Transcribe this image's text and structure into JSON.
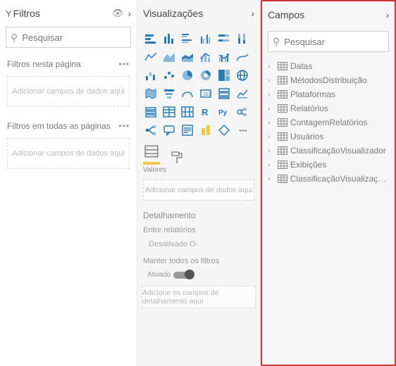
{
  "filters": {
    "title": "Filtros",
    "search_placeholder": "Pesquisar",
    "section_page": "Filtros nesta página",
    "section_all": "Filtros em todas as páginas",
    "dropzone_text": "Adicionar campos de dados aqui"
  },
  "viz": {
    "title": "Visualizações",
    "values_label": "Valores",
    "dropzone_text": "Adicionar campos de dados aqui",
    "drill_header": "Detalhamento",
    "cross_report_label": "Entre relatórios",
    "cross_report_state": "Desativado O-",
    "keep_filters_label": "Manter todos os filtros",
    "keep_filters_state": "Ativado",
    "drill_dropzone": "Adicione os campos de detalhamento aqui",
    "icons": [
      "stacked-bar",
      "stacked-column",
      "clustered-bar",
      "clustered-column",
      "hundred-bar",
      "hundred-column",
      "line",
      "area",
      "stacked-area",
      "line-stacked-col",
      "line-clustered-col",
      "ribbon",
      "waterfall",
      "scatter",
      "pie",
      "donut",
      "treemap",
      "map",
      "filled-map",
      "funnel",
      "gauge",
      "card",
      "multi-card",
      "kpi",
      "slicer",
      "table",
      "matrix",
      "r-visual",
      "py-visual",
      "key-influencers",
      "decomposition",
      "qa",
      "narrative",
      "paginated",
      "powerapps",
      "store"
    ]
  },
  "fields": {
    "title": "Campos",
    "search_placeholder": "Pesquisar",
    "tables": [
      "Datas",
      "MétodosDistribuição",
      "Plataformas",
      "Relatórios",
      "ContagemRelatórios",
      "Usuários",
      "ClassificaçãoVisualizador",
      "Exibições",
      "ClassificaçãoVisualizações"
    ]
  }
}
